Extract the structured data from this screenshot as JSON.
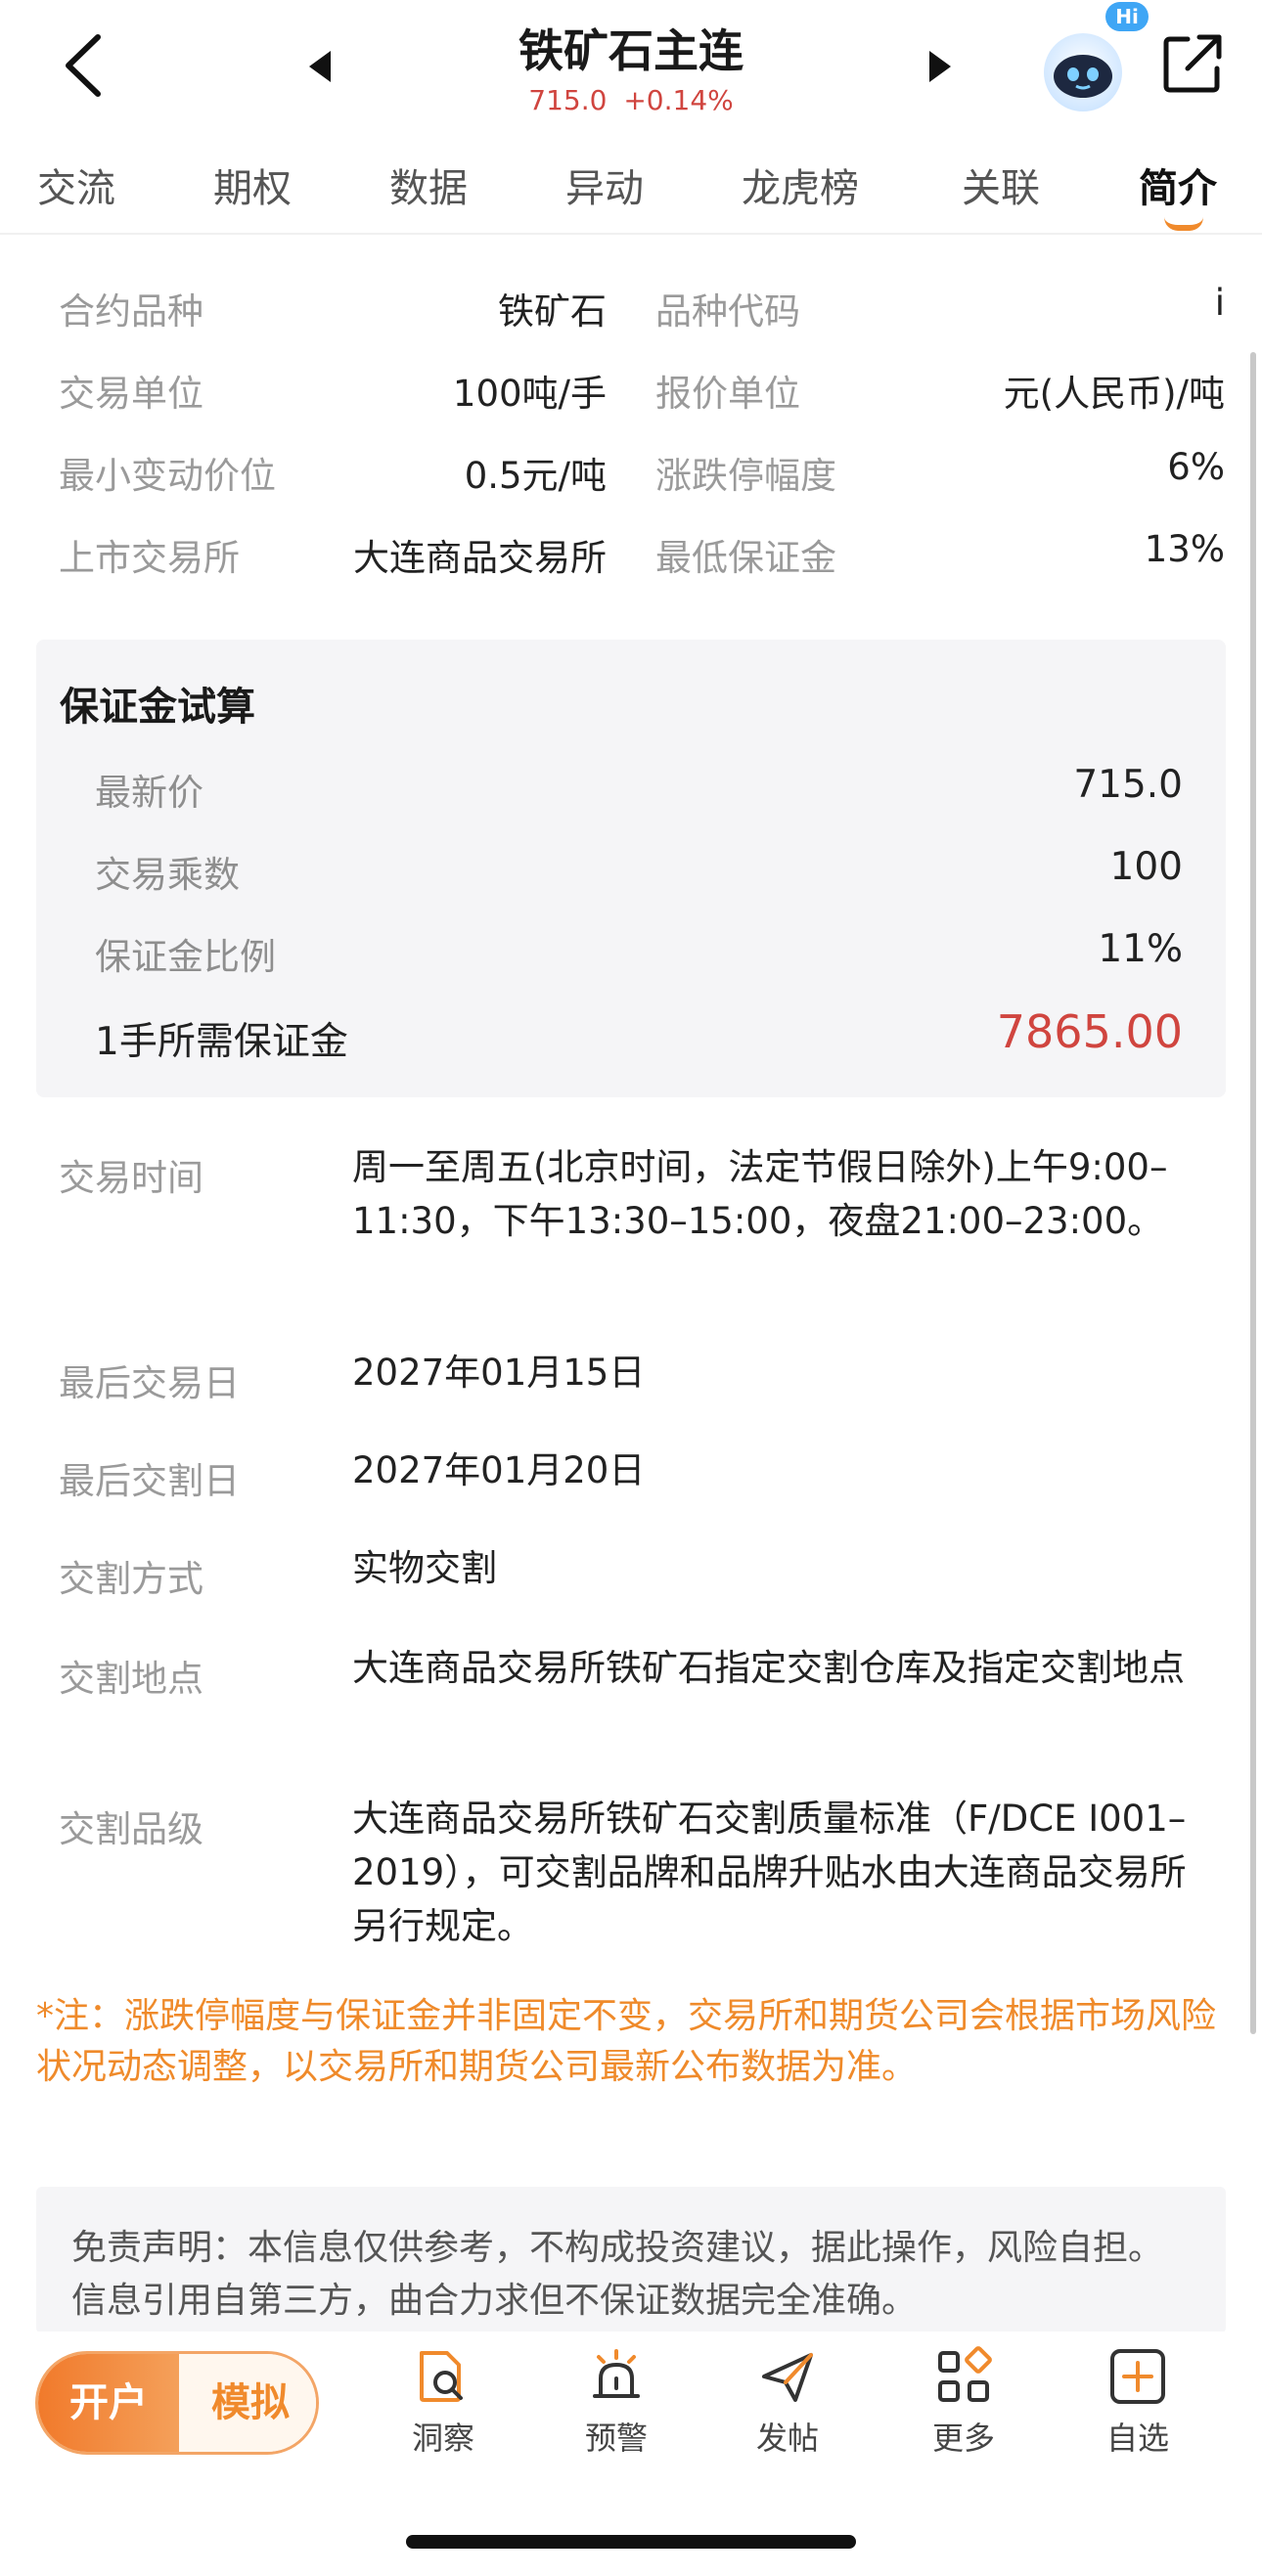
{
  "header": {
    "title": "铁矿石主连",
    "price": "715.0",
    "change": "+0.14%",
    "hi_badge": "Hi",
    "price_color": "#d0453f"
  },
  "tabs": [
    {
      "label": "交流"
    },
    {
      "label": "期权"
    },
    {
      "label": "数据"
    },
    {
      "label": "异动"
    },
    {
      "label": "龙虎榜"
    },
    {
      "label": "关联"
    },
    {
      "label": "简介",
      "active": true
    }
  ],
  "spec": {
    "rows": [
      {
        "l1": "合约品种",
        "v1": "铁矿石",
        "l2": "品种代码",
        "v2": "i"
      },
      {
        "l1": "交易单位",
        "v1": "100吨/手",
        "l2": "报价单位",
        "v2": "元(人民币)/吨"
      },
      {
        "l1": "最小变动价位",
        "v1": "0.5元/吨",
        "l2": "涨跌停幅度",
        "v2": "6%"
      },
      {
        "l1": "上市交易所",
        "v1": "大连商品交易所",
        "l2": "最低保证金",
        "v2": "13%"
      }
    ]
  },
  "calc": {
    "title": "保证金试算",
    "rows": [
      {
        "k": "最新价",
        "v": "715.0"
      },
      {
        "k": "交易乘数",
        "v": "100"
      },
      {
        "k": "保证金比例",
        "v": "11%"
      }
    ],
    "total": {
      "k": "1手所需保证金",
      "v": "7865.00"
    }
  },
  "details": [
    {
      "label": "交易时间",
      "value": "周一至周五(北京时间，法定节假日除外)上午9:00–11:30，下午13:30–15:00，夜盘21:00–23:00。"
    },
    {
      "label": "最后交易日",
      "value": "2027年01月15日"
    },
    {
      "label": "最后交割日",
      "value": "2027年01月20日"
    },
    {
      "label": "交割方式",
      "value": "实物交割"
    },
    {
      "label": "交割地点",
      "value": "大连商品交易所铁矿石指定交割仓库及指定交割地点"
    },
    {
      "label": "交割品级",
      "value": "大连商品交易所铁矿石交割质量标准（F/DCE I001–2019），可交割品牌和品牌升贴水由大连商品交易所另行规定。"
    }
  ],
  "note": "*注：涨跌停幅度与保证金并非固定不变，交易所和期货公司会根据市场风险状况动态调整，以交易所和期货公司最新公布数据为准。",
  "disclaimer": "免责声明：本信息仅供参考，不构成投资建议，据此操作，风险自担。信息引用自第三方，曲合力求但不保证数据完全准确。",
  "bottombar": {
    "open_label": "开户",
    "sim_label": "模拟",
    "items": [
      {
        "label": "洞察",
        "icon": "insight-icon"
      },
      {
        "label": "预警",
        "icon": "alarm-icon"
      },
      {
        "label": "发帖",
        "icon": "send-icon"
      },
      {
        "label": "更多",
        "icon": "more-icon"
      },
      {
        "label": "自选",
        "icon": "add-watchlist-icon"
      }
    ]
  },
  "colors": {
    "accent": "#f08a2c",
    "red": "#d0453f"
  }
}
